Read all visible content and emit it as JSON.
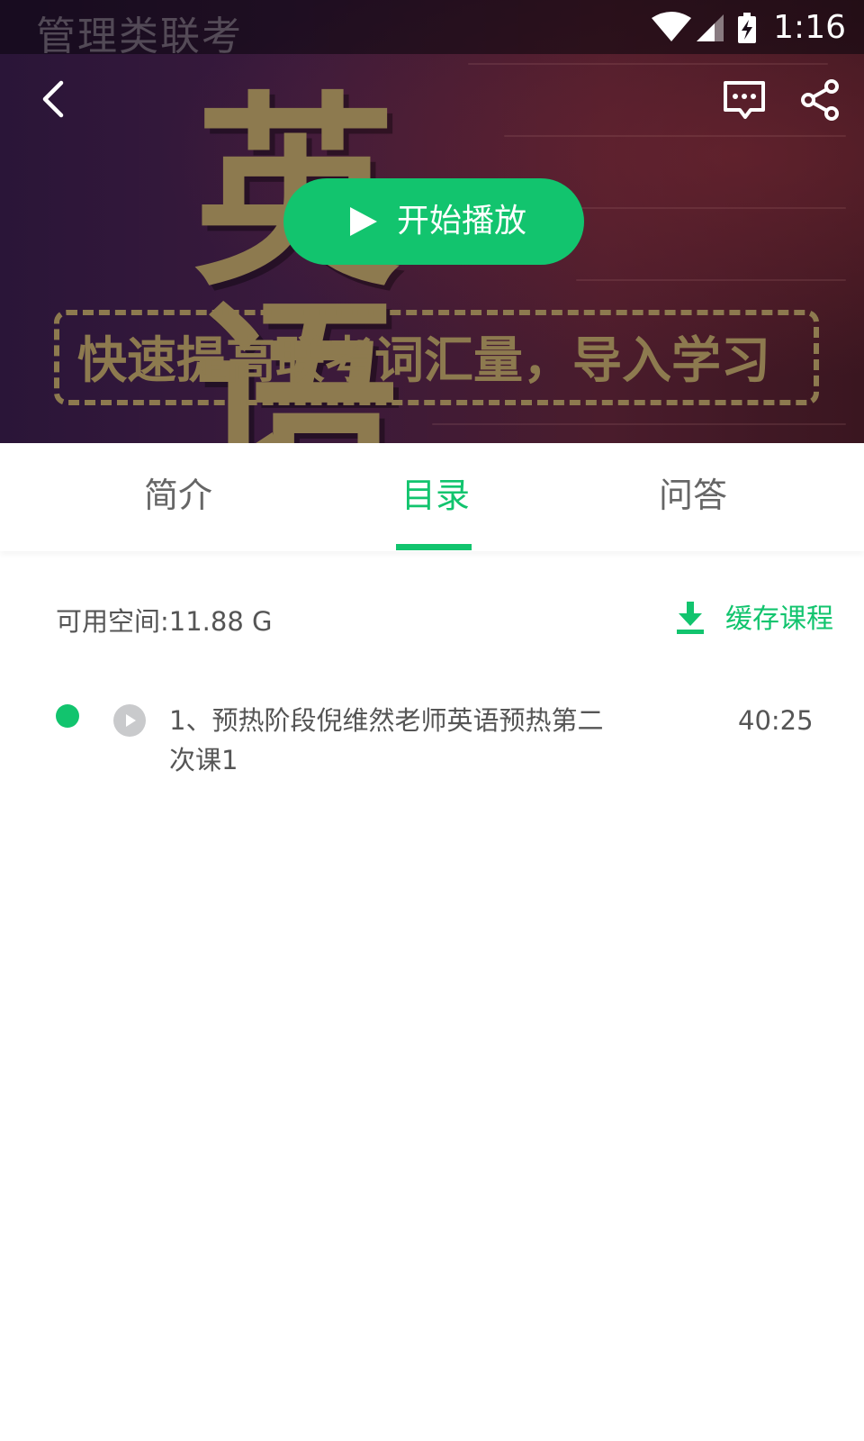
{
  "status_bar": {
    "app_watermark": "管理类联考",
    "time": "1:16"
  },
  "cover": {
    "title": "英语",
    "subtitle": "快速提高联考词汇量，导入学习"
  },
  "player": {
    "play_label": "开始播放"
  },
  "tabs": [
    {
      "label": "简介",
      "active": false
    },
    {
      "label": "目录",
      "active": true
    },
    {
      "label": "问答",
      "active": false
    }
  ],
  "catalog": {
    "storage_text": "可用空间:11.88 G",
    "cache_label": "缓存课程",
    "lessons": [
      {
        "title": "1、预热阶段倪维然老师英语预热第二次课1",
        "duration": "40:25"
      }
    ]
  },
  "colors": {
    "accent": "#12c46e",
    "cover_text": "#8d7a4f",
    "muted_text": "#555555",
    "tab_inactive": "#666666"
  },
  "icons": [
    "back-icon",
    "comment-icon",
    "share-icon",
    "play-icon",
    "download-icon",
    "wifi-icon",
    "signal-icon",
    "battery-icon"
  ]
}
